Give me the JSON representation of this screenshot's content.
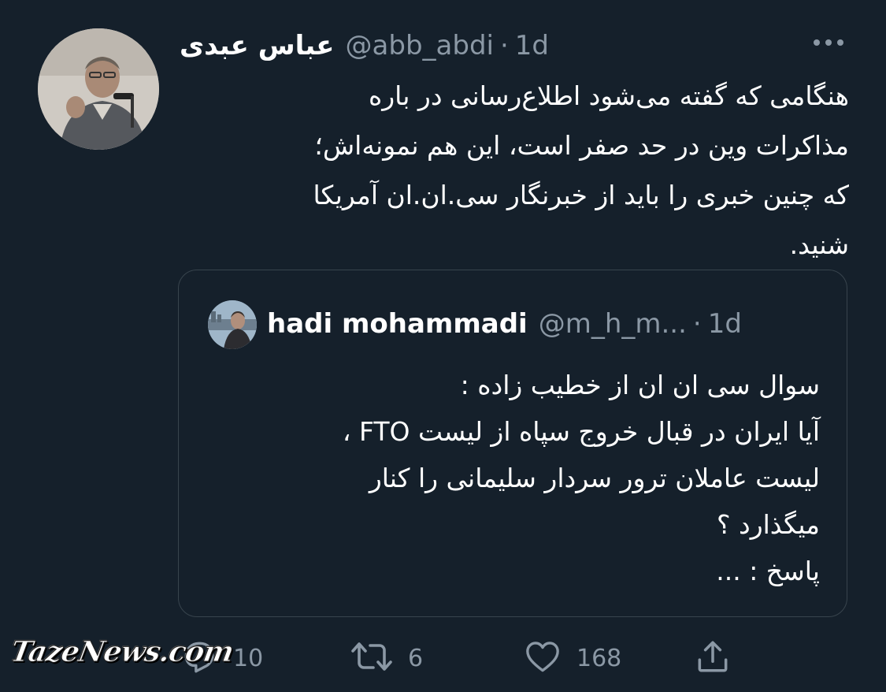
{
  "tweet": {
    "author": {
      "name": "عباس عبدی",
      "handle": "@abb_abdi",
      "separator": "·",
      "time": "1d"
    },
    "text_lines": [
      "هنگامی که گفته می‌شود اطلاع‌رسانی در باره",
      "مذاکرات وین در حد صفر است، این هم نمونه‌اش؛",
      "که چنین خبری را باید از خبرنگار سی.ان.ان آمریکا",
      "شنید."
    ],
    "quoted": {
      "name": "hadi mohammadi",
      "handle": "@m_h_m...",
      "separator": "·",
      "time": "1d",
      "text_lines": [
        "سوال سی ان ان از خطیب زاده :",
        "آیا ایران در قبال خروج سپاه از لیست FTO ،",
        "لیست عاملان ترور سردار سلیمانی را کنار",
        "میگذارد ؟",
        "پاسخ : ..."
      ]
    },
    "actions": {
      "reply_count": "10",
      "retweet_count": "6",
      "like_count": "168"
    },
    "icons": [
      "more-icon",
      "reply-icon",
      "retweet-icon",
      "like-icon",
      "share-icon"
    ]
  },
  "watermark": {
    "text": "TazeNews.com"
  },
  "colors": {
    "background": "#15202b",
    "primary_text": "#ffffff",
    "secondary_text": "#8b98a5",
    "border": "#38444d"
  }
}
